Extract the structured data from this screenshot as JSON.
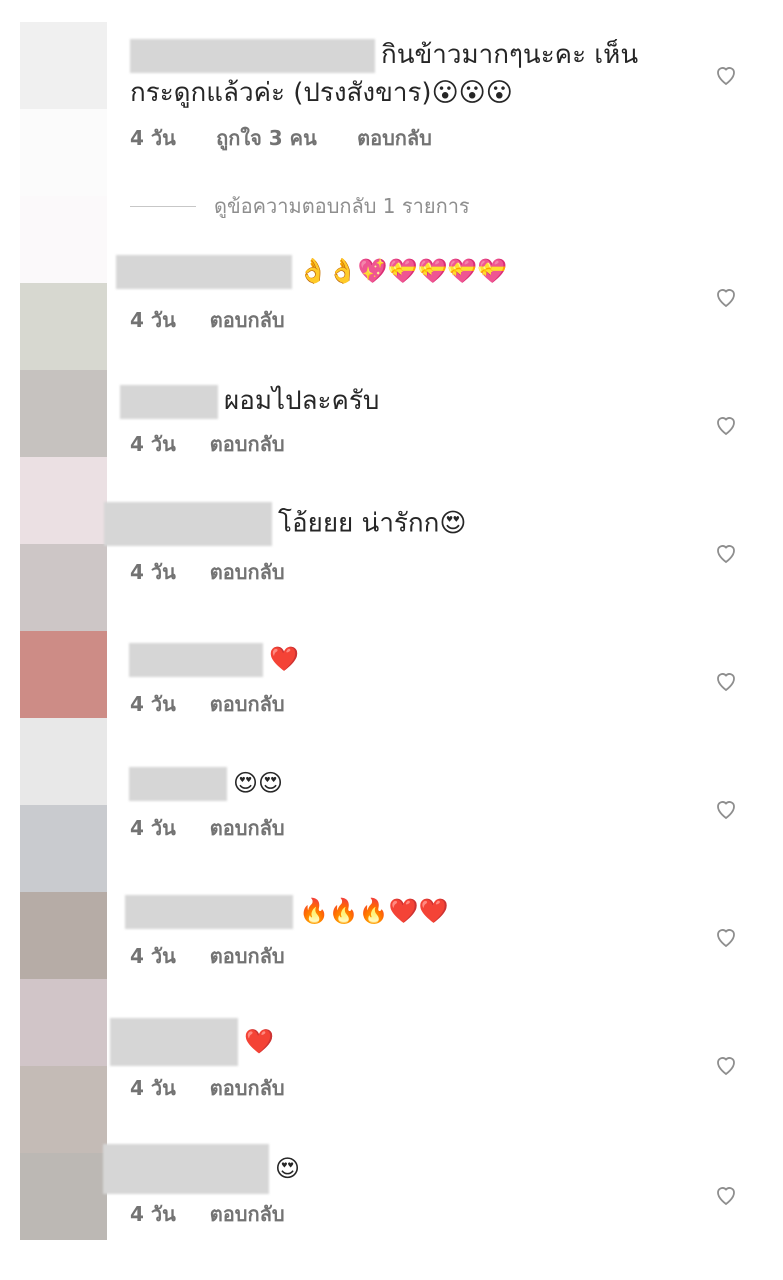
{
  "comments": [
    {
      "text": "กินข้าวมากๆนะคะ เห็นกระดูกแล้วค่ะ (ปรงสังขาร)😮😮😮",
      "time": "4 วัน",
      "likes": "ถูกใจ 3 คน",
      "reply": "ตอบกลับ"
    },
    {
      "text": "👌👌💖💝💝💝💝",
      "time": "4 วัน",
      "reply": "ตอบกลับ"
    },
    {
      "text": "ผอมไปละครับ",
      "time": "4 วัน",
      "reply": "ตอบกลับ"
    },
    {
      "text": "โอ้ยยย น่ารักก😍",
      "time": "4 วัน",
      "reply": "ตอบกลับ"
    },
    {
      "text": "❤️",
      "time": "4 วัน",
      "reply": "ตอบกลับ"
    },
    {
      "text": "😍😍",
      "time": "4 วัน",
      "reply": "ตอบกลับ"
    },
    {
      "text": "🔥🔥🔥❤️❤️",
      "time": "4 วัน",
      "reply": "ตอบกลับ"
    },
    {
      "text": "❤️",
      "time": "4 วัน",
      "reply": "ตอบกลับ"
    },
    {
      "text": "😍",
      "time": "4 วัน",
      "reply": "ตอบกลับ"
    }
  ],
  "view_replies": "ดูข้อความตอบกลับ 1 รายการ"
}
